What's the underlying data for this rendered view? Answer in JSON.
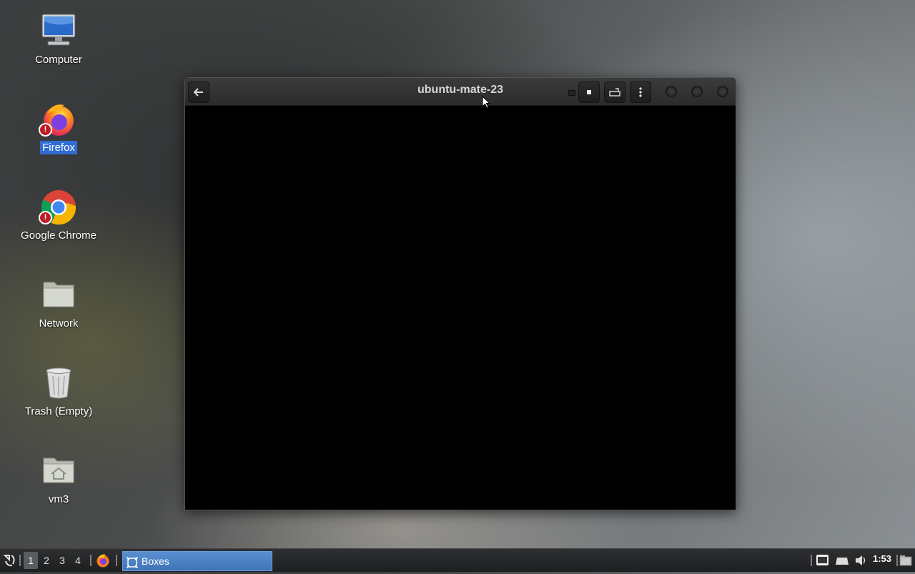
{
  "desktop": {
    "icons": [
      {
        "label": "Computer",
        "icon": "computer-icon"
      },
      {
        "label": "Firefox",
        "icon": "firefox-icon",
        "selected": true
      },
      {
        "label": "Google Chrome",
        "icon": "chrome-icon"
      },
      {
        "label": "Network",
        "icon": "folder-icon"
      },
      {
        "label": "Trash (Empty)",
        "icon": "trash-icon"
      },
      {
        "label": "vm3",
        "icon": "home-folder-icon"
      }
    ],
    "warning_badge": "!"
  },
  "window": {
    "title": "ubuntu-mate-23",
    "content_color": "#000000"
  },
  "taskbar": {
    "workspaces": [
      "1",
      "2",
      "3",
      "4"
    ],
    "active_workspace": "1",
    "task_label": "Boxes",
    "clock": "1:53"
  },
  "colors": {
    "selection": "#2f6cd4",
    "task_active": "#4a80c4"
  }
}
